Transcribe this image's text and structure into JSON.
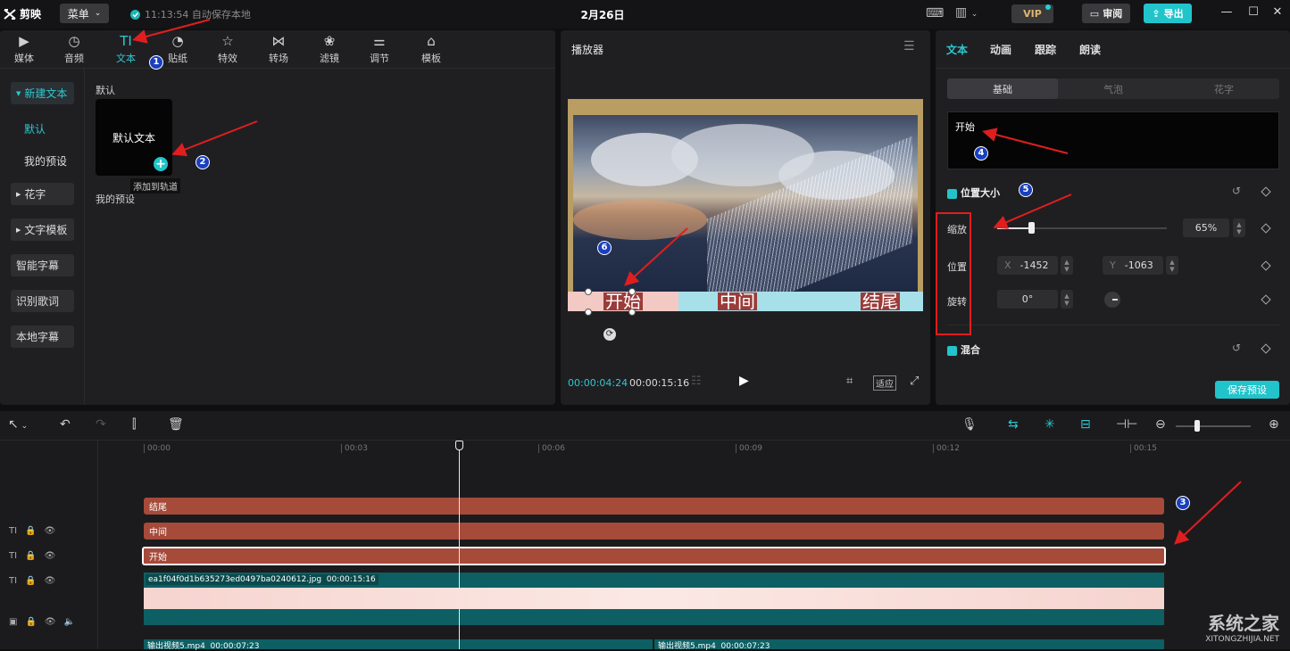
{
  "app": {
    "name": "剪映",
    "menu_label": "菜单",
    "save_status": "11:13:54 自动保存本地",
    "doc_title": "2月26日",
    "vip_label": "VIP",
    "review_label": "审阅",
    "export_label": "导出"
  },
  "toolbar": [
    {
      "label": "媒体",
      "icon": "media-icon"
    },
    {
      "label": "音频",
      "icon": "audio-icon"
    },
    {
      "label": "文本",
      "icon": "text-icon",
      "active": true
    },
    {
      "label": "贴纸",
      "icon": "sticker-icon"
    },
    {
      "label": "特效",
      "icon": "effects-icon"
    },
    {
      "label": "转场",
      "icon": "transition-icon"
    },
    {
      "label": "滤镜",
      "icon": "filter-icon"
    },
    {
      "label": "调节",
      "icon": "adjust-icon"
    },
    {
      "label": "模板",
      "icon": "template-icon"
    }
  ],
  "sidebar": {
    "new_text": "新建文本",
    "default": "默认",
    "my_presets": "我的预设",
    "huazi": "花字",
    "text_template": "文字模板",
    "smart_subtitle": "智能字幕",
    "lyrics": "识别歌词",
    "local_subtitle": "本地字幕"
  },
  "content": {
    "default_section": "默认",
    "card_label": "默认文本",
    "tooltip": "添加到轨道",
    "my_presets_section": "我的预设"
  },
  "player": {
    "title": "播放器",
    "strips": [
      {
        "text": "开始",
        "color": "#f3c9c4"
      },
      {
        "text": "中间",
        "color": "#a8e0ea"
      },
      {
        "text": "结尾",
        "color": "#a8e0ea"
      }
    ],
    "current_time": "00:00:04:24",
    "total_time": "00:00:15:16",
    "fit_label": "适应"
  },
  "inspector": {
    "tabs": [
      "文本",
      "动画",
      "跟踪",
      "朗读"
    ],
    "sub_tabs": [
      "基础",
      "气泡",
      "花字"
    ],
    "text_value": "开始",
    "position_size_label": "位置大小",
    "scale_label": "缩放",
    "scale_value": "65%",
    "scale_fraction": 0.2,
    "position_label": "位置",
    "x_label": "X",
    "x_value": "-1452",
    "y_label": "Y",
    "y_value": "-1063",
    "rotate_label": "旋转",
    "rotate_value": "0°",
    "blend_label": "混合",
    "save_preset": "保存预设"
  },
  "timeline": {
    "ruler": [
      "00:00",
      "00:03",
      "00:06",
      "00:09",
      "00:12",
      "00:15"
    ],
    "tracks": [
      {
        "type": "text",
        "clip": "结尾"
      },
      {
        "type": "text",
        "clip": "中间"
      },
      {
        "type": "text",
        "clip": "开始",
        "selected": true
      }
    ],
    "video_clip": {
      "name": "ea1f04f0d1b635273ed0497ba0240612.jpg",
      "duration": "00:00:15:16"
    },
    "audio_clips": [
      {
        "name": "输出视频5.mp4",
        "duration": "00:00:07:23"
      },
      {
        "name": "输出视频5.mp4",
        "duration": "00:00:07:23"
      }
    ]
  },
  "annotations": [
    "1",
    "2",
    "3",
    "4",
    "5",
    "6"
  ],
  "watermark": {
    "main": "系统之家",
    "url": "XITONGZHIJIA.NET"
  },
  "colors": {
    "accent": "#22c4cc",
    "clip": "#a64a3a",
    "annotation_red": "#e01e1e",
    "badge_blue": "#1a3fbf"
  }
}
